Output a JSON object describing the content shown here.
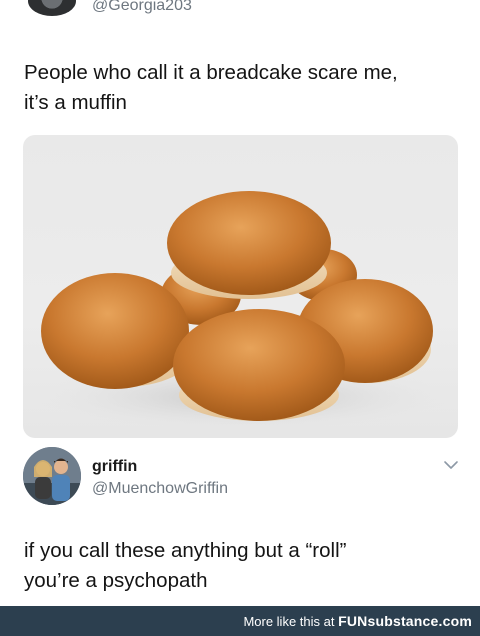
{
  "original_tweet": {
    "handle": "@Georgia203",
    "text_line1": "People who call it a breadcake scare me,",
    "text_line2": "it’s a muffin"
  },
  "reply": {
    "name": "griffin",
    "handle": "@MuenchowGriffin",
    "text_line1": "if you call these anything but a “roll”",
    "text_line2": "you’re a psychopath"
  },
  "footer": {
    "prefix": "More like this at ",
    "brand": "FUNsubstance.com"
  },
  "colors": {
    "footer_bg": "#2c3f4f",
    "handle_gray": "#6e7780"
  },
  "icons": [
    "top-avatar",
    "reply-avatar",
    "chevron-down-icon"
  ]
}
